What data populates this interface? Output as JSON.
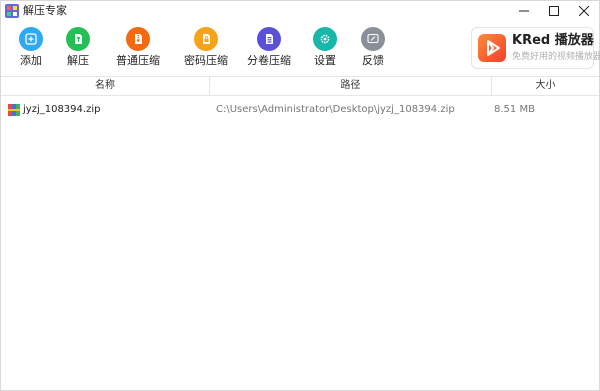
{
  "window": {
    "title": "解压专家"
  },
  "toolbar": {
    "items": [
      {
        "label": "添加",
        "icon": "add-icon",
        "color": "#2fa9f2"
      },
      {
        "label": "解压",
        "icon": "extract-icon",
        "color": "#26bf57"
      },
      {
        "label": "普通压缩",
        "icon": "compress-icon",
        "color": "#f46a12"
      },
      {
        "label": "密码压缩",
        "icon": "password-compress-icon",
        "color": "#f5a31a"
      },
      {
        "label": "分卷压缩",
        "icon": "split-compress-icon",
        "color": "#5a52d6"
      },
      {
        "label": "设置",
        "icon": "gear-icon",
        "color": "#17b7a9"
      },
      {
        "label": "反馈",
        "icon": "feedback-icon",
        "color": "#8a8f99"
      }
    ]
  },
  "ad": {
    "title": "KRed 播放器",
    "subtitle": "免费好用的视频播放器"
  },
  "columns": {
    "name": "名称",
    "path": "路径",
    "size": "大小"
  },
  "files": [
    {
      "name": "jyzj_108394.zip",
      "path": "C:\\Users\\Administrator\\Desktop\\jyzj_108394.zip",
      "size": "8.51 MB",
      "icon": "zip-file-icon"
    }
  ]
}
